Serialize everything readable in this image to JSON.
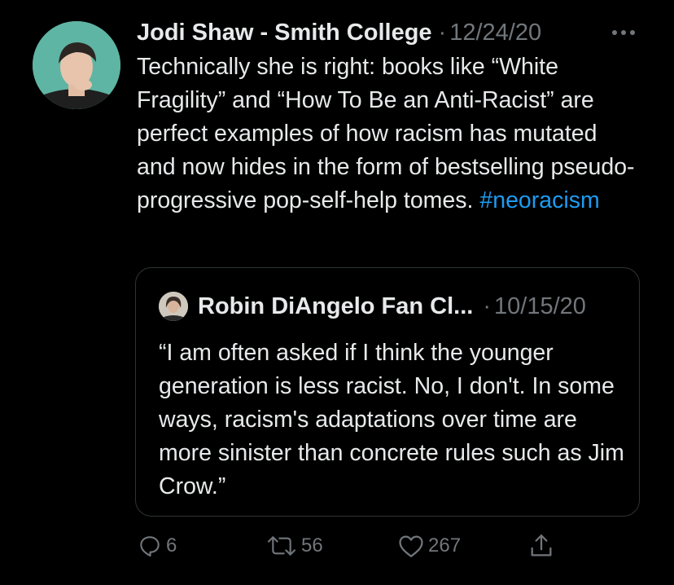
{
  "tweet": {
    "author_name": "Jodi Shaw - Smith College",
    "separator": "·",
    "date": "12/24/20",
    "text": "Technically she is right: books like “White Fragility” and “How To Be an Anti-Racist” are perfect examples of how racism has mutated and now hides in the form of bestselling pseudo-progressive pop-self-help tomes. ",
    "hashtag": "#neoracism",
    "more_icon": "more-horizontal-icon"
  },
  "quoted": {
    "author_name": "Robin DiAngelo Fan Cl...",
    "separator": "·",
    "date": "10/15/20",
    "text": "“I am often asked if I think the younger generation is less racist. No, I don't. In some ways, racism's adaptations over time are more sinister than concrete rules such as Jim Crow.”"
  },
  "actions": {
    "reply": {
      "icon": "reply-icon",
      "count": "6"
    },
    "retweet": {
      "icon": "retweet-icon",
      "count": "56"
    },
    "like": {
      "icon": "heart-icon",
      "count": "267"
    },
    "share": {
      "icon": "share-icon"
    }
  },
  "colors": {
    "background": "#000000",
    "text": "#e7e9ea",
    "muted": "#71767b",
    "accent": "#1d9bf0",
    "border": "#2f3336"
  }
}
